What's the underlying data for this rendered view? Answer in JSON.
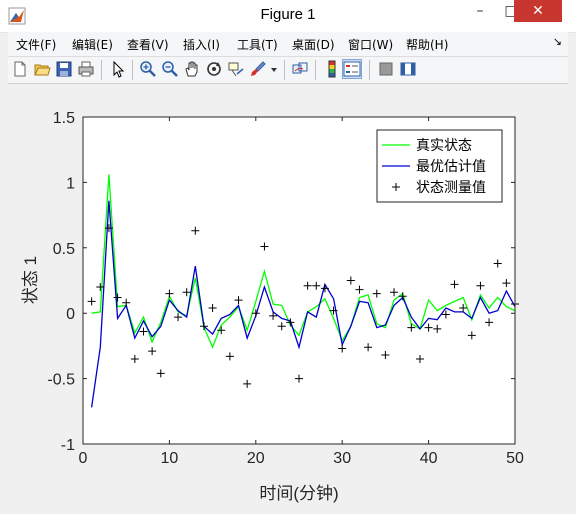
{
  "window": {
    "title": "Figure 1",
    "minimize": "–",
    "maximize": "□",
    "close": "✕"
  },
  "menu": [
    {
      "label": "文件(F)"
    },
    {
      "label": "编辑(E)"
    },
    {
      "label": "查看(V)"
    },
    {
      "label": "插入(I)"
    },
    {
      "label": "工具(T)"
    },
    {
      "label": "桌面(D)"
    },
    {
      "label": "窗口(W)"
    },
    {
      "label": "帮助(H)"
    }
  ],
  "toolbar": [
    "new-figure-icon",
    "open-file-icon",
    "save-icon",
    "print-icon",
    "select-arrow-icon",
    "zoom-in-icon",
    "zoom-out-icon",
    "pan-hand-icon",
    "rotate-3d-icon",
    "data-cursor-icon",
    "brush-icon",
    "brush-dropdown-icon",
    "link-plot-icon",
    "colorbar-icon",
    "legend-icon",
    "hide-plot-tools-icon",
    "show-plot-tools-icon"
  ],
  "chart_data": {
    "type": "line",
    "xlabel": "时间(分钟)",
    "ylabel": "状态 1",
    "xlim": [
      0,
      50
    ],
    "ylim": [
      -1,
      1.5
    ],
    "xticks": [
      0,
      10,
      20,
      30,
      40,
      50
    ],
    "yticks": [
      -1,
      -0.5,
      0,
      0.5,
      1,
      1.5
    ],
    "xtick_labels": [
      "0",
      "10",
      "20",
      "30",
      "40",
      "50"
    ],
    "ytick_labels": [
      "-1",
      "-0.5",
      "0",
      "0.5",
      "1",
      "1.5"
    ],
    "legend_position": "top-right",
    "grid": false,
    "series": [
      {
        "name": "真实状态",
        "style": "line",
        "color": "#00ff00",
        "x": [
          1,
          2,
          3,
          4,
          5,
          6,
          7,
          8,
          9,
          10,
          11,
          12,
          13,
          14,
          15,
          16,
          17,
          18,
          19,
          20,
          21,
          22,
          23,
          24,
          25,
          26,
          27,
          28,
          29,
          30,
          31,
          32,
          33,
          34,
          35,
          36,
          37,
          38,
          39,
          40,
          41,
          42,
          43,
          44,
          45,
          46,
          47,
          48,
          49,
          50
        ],
        "y": [
          0,
          0.01,
          1.06,
          0.05,
          0.06,
          -0.15,
          -0.03,
          -0.22,
          -0.07,
          0.13,
          0.01,
          -0.02,
          0.27,
          -0.11,
          -0.26,
          -0.09,
          -0.03,
          0.05,
          -0.13,
          0.09,
          0.32,
          0.07,
          0.06,
          -0.09,
          -0.17,
          0.01,
          0.05,
          0.11,
          -0.04,
          -0.21,
          -0.1,
          0.12,
          0.14,
          -0.08,
          -0.11,
          0.1,
          0.15,
          -0.08,
          -0.12,
          0.1,
          0.02,
          0.06,
          0.09,
          0.12,
          -0.05,
          0.14,
          0.04,
          0.12,
          0.05,
          0.02
        ]
      },
      {
        "name": "最优估计值",
        "style": "line",
        "color": "#0000cd",
        "x": [
          1,
          2,
          3,
          4,
          5,
          6,
          7,
          8,
          9,
          10,
          11,
          12,
          13,
          14,
          15,
          16,
          17,
          18,
          19,
          20,
          21,
          22,
          23,
          24,
          25,
          26,
          27,
          28,
          29,
          30,
          31,
          32,
          33,
          34,
          35,
          36,
          37,
          38,
          39,
          40,
          41,
          42,
          43,
          44,
          45,
          46,
          47,
          48,
          49,
          50
        ],
        "y": [
          -0.72,
          -0.26,
          0.86,
          -0.04,
          0.06,
          -0.19,
          -0.06,
          -0.18,
          -0.1,
          0.1,
          0.02,
          -0.03,
          0.36,
          -0.1,
          -0.16,
          -0.04,
          -0.01,
          0.06,
          -0.19,
          -0.02,
          0.2,
          0.01,
          -0.04,
          -0.06,
          -0.26,
          0.01,
          -0.03,
          0.22,
          0.11,
          -0.24,
          -0.1,
          0.09,
          0.08,
          -0.11,
          -0.09,
          0.06,
          0.12,
          -0.03,
          -0.12,
          -0.04,
          -0.05,
          0.04,
          0.01,
          0.01,
          -0.04,
          0.12,
          0.0,
          0.02,
          0.17,
          0.05
        ]
      },
      {
        "name": "状态测量值",
        "style": "marker",
        "marker": "+",
        "color": "#000000",
        "x": [
          1,
          2,
          3,
          4,
          5,
          6,
          7,
          8,
          9,
          10,
          11,
          12,
          13,
          14,
          15,
          16,
          17,
          18,
          19,
          20,
          21,
          22,
          23,
          24,
          25,
          26,
          27,
          28,
          29,
          30,
          31,
          32,
          33,
          34,
          35,
          36,
          37,
          38,
          39,
          40,
          41,
          42,
          43,
          44,
          45,
          46,
          47,
          48,
          49,
          50
        ],
        "y": [
          0.09,
          0.2,
          0.65,
          0.12,
          0.08,
          -0.35,
          -0.14,
          -0.29,
          -0.46,
          0.15,
          -0.03,
          0.16,
          0.63,
          -0.1,
          0.04,
          -0.13,
          -0.33,
          0.1,
          -0.54,
          0.0,
          0.51,
          -0.02,
          -0.1,
          -0.07,
          -0.5,
          0.21,
          0.21,
          0.19,
          0.02,
          -0.27,
          0.25,
          0.18,
          -0.26,
          0.15,
          -0.32,
          0.16,
          0.13,
          -0.11,
          -0.35,
          -0.11,
          -0.12,
          -0.01,
          0.22,
          0.04,
          -0.17,
          0.21,
          -0.07,
          0.38,
          0.23,
          0.07
        ]
      }
    ]
  }
}
